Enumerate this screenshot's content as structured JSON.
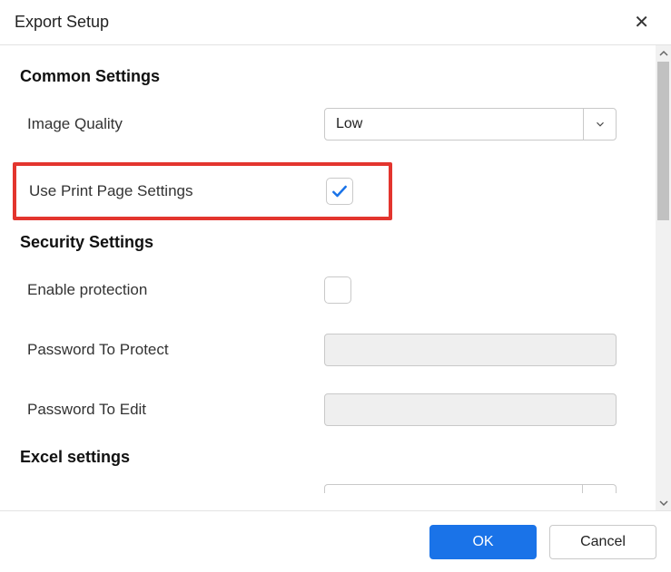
{
  "dialog": {
    "title": "Export Setup"
  },
  "sections": {
    "common": {
      "title": "Common Settings",
      "image_quality_label": "Image Quality",
      "image_quality_value": "Low",
      "use_print_page_label": "Use Print Page Settings",
      "use_print_page_checked": true
    },
    "security": {
      "title": "Security Settings",
      "enable_protection_label": "Enable protection",
      "enable_protection_checked": false,
      "password_protect_label": "Password To Protect",
      "password_protect_value": "",
      "password_edit_label": "Password To Edit",
      "password_edit_value": ""
    },
    "excel": {
      "title": "Excel settings"
    }
  },
  "footer": {
    "ok_label": "OK",
    "cancel_label": "Cancel"
  }
}
